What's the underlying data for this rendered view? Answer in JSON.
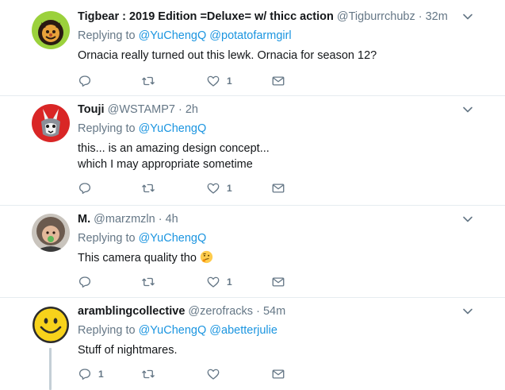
{
  "tweets": [
    {
      "name": "Tigbear : 2019 Edition =Deluxe= w/ thicc action",
      "handle": "@Tigburrchubz",
      "time": "32m",
      "replying_prefix": "Replying to ",
      "replying": [
        "@YuChengQ",
        "@potatofarmgirl"
      ],
      "text_lines": [
        "Ornacia really turned out this lewk. Ornacia for season 12?"
      ],
      "reply_count": "",
      "retweet_count": "",
      "like_count": "1"
    },
    {
      "name": "Touji",
      "handle": "@WSTAMP7",
      "time": "2h",
      "replying_prefix": "Replying to ",
      "replying": [
        "@YuChengQ"
      ],
      "text_lines": [
        "this... is an amazing design concept...",
        "which I may appropriate sometime"
      ],
      "reply_count": "",
      "retweet_count": "",
      "like_count": "1"
    },
    {
      "name": "M.",
      "handle": "@marzmzln",
      "time": "4h",
      "replying_prefix": "Replying to ",
      "replying": [
        "@YuChengQ"
      ],
      "text_lines": [
        "This camera quality tho"
      ],
      "emoji": "thinking-face",
      "reply_count": "",
      "retweet_count": "",
      "like_count": "1"
    },
    {
      "name": "aramblingcollective",
      "handle": "@zerofracks",
      "time": "54m",
      "replying_prefix": "Replying to ",
      "replying": [
        "@YuChengQ",
        "@abetterjulie"
      ],
      "text_lines": [
        "Stuff of nightmares."
      ],
      "reply_count": "1",
      "retweet_count": "",
      "like_count": ""
    }
  ],
  "separator": "·",
  "colors": {
    "text": "#14171a",
    "secondary": "#657786",
    "link": "#1b95e0",
    "divider": "#e6ecf0",
    "thread_line": "#c4cfd6"
  },
  "icons": [
    "reply-icon",
    "retweet-icon",
    "like-icon",
    "direct-message-icon",
    "chevron-down-icon"
  ]
}
